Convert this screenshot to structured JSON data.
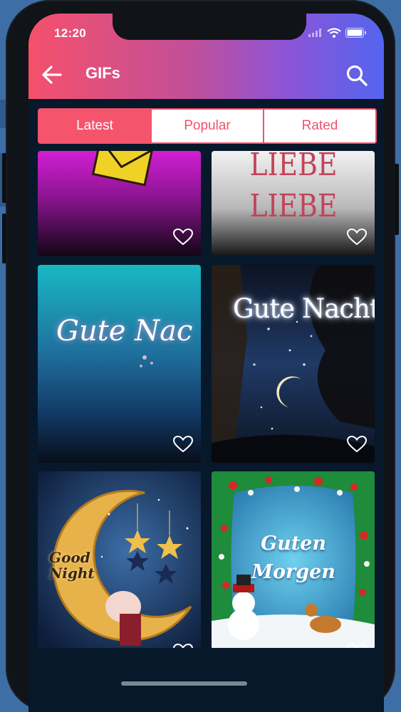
{
  "status_bar": {
    "time": "12:20"
  },
  "header": {
    "title": "GIFs",
    "back_icon": "arrow-left-icon",
    "search_icon": "search-icon"
  },
  "colors": {
    "accent": "#f5506b",
    "gradient_start": "#f5506b",
    "gradient_end": "#5365ef",
    "background": "#06182a"
  },
  "tabs": [
    {
      "label": "Latest",
      "active": true
    },
    {
      "label": "Popular",
      "active": false
    },
    {
      "label": "Rated",
      "active": false
    }
  ],
  "gifs": [
    {
      "caption": "",
      "favorite": false
    },
    {
      "caption": "LIEBE LIEBE",
      "favorite": false
    },
    {
      "caption": "Gute Nac",
      "favorite": false
    },
    {
      "caption": "Gute Nacht",
      "favorite": false
    },
    {
      "caption": "Good Night",
      "favorite": false
    },
    {
      "caption": "Guten Morgen",
      "favorite": false
    }
  ]
}
